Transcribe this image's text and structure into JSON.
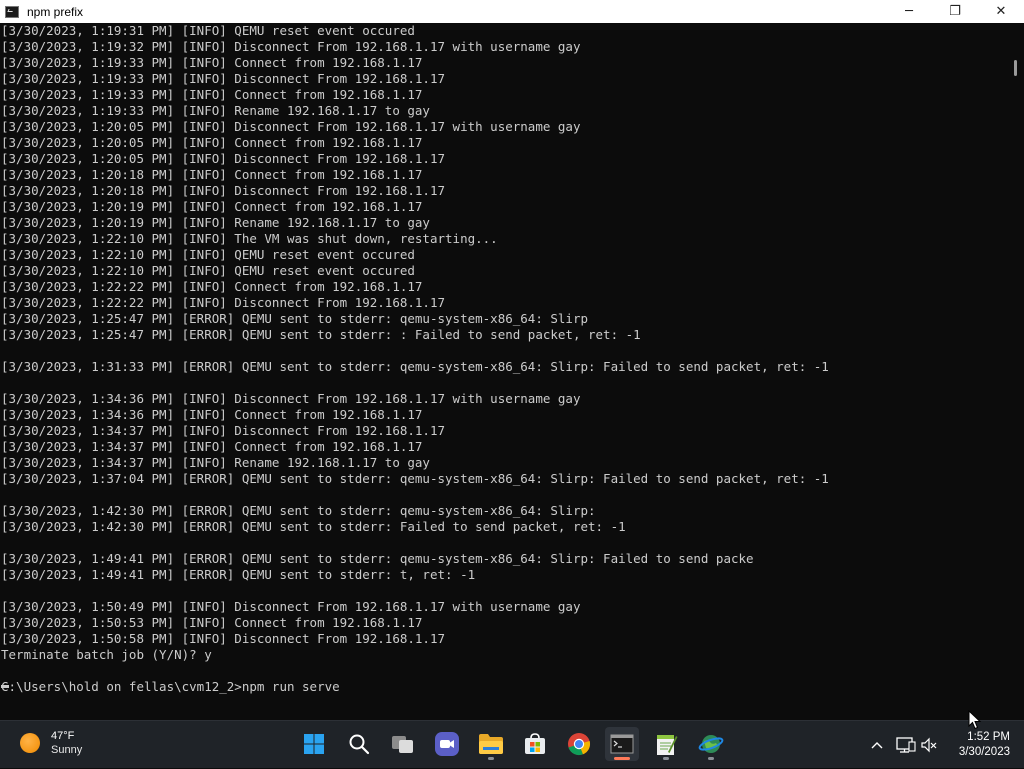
{
  "window": {
    "title": "npm prefix",
    "minimize_glyph": "─",
    "maximize_glyph": "❐",
    "close_glyph": "✕"
  },
  "console": {
    "lines": [
      "[3/30/2023, 1:19:31 PM] [INFO] QEMU reset event occured",
      "[3/30/2023, 1:19:32 PM] [INFO] Disconnect From 192.168.1.17 with username gay",
      "[3/30/2023, 1:19:33 PM] [INFO] Connect from 192.168.1.17",
      "[3/30/2023, 1:19:33 PM] [INFO] Disconnect From 192.168.1.17",
      "[3/30/2023, 1:19:33 PM] [INFO] Connect from 192.168.1.17",
      "[3/30/2023, 1:19:33 PM] [INFO] Rename 192.168.1.17 to gay",
      "[3/30/2023, 1:20:05 PM] [INFO] Disconnect From 192.168.1.17 with username gay",
      "[3/30/2023, 1:20:05 PM] [INFO] Connect from 192.168.1.17",
      "[3/30/2023, 1:20:05 PM] [INFO] Disconnect From 192.168.1.17",
      "[3/30/2023, 1:20:18 PM] [INFO] Connect from 192.168.1.17",
      "[3/30/2023, 1:20:18 PM] [INFO] Disconnect From 192.168.1.17",
      "[3/30/2023, 1:20:19 PM] [INFO] Connect from 192.168.1.17",
      "[3/30/2023, 1:20:19 PM] [INFO] Rename 192.168.1.17 to gay",
      "[3/30/2023, 1:22:10 PM] [INFO] The VM was shut down, restarting...",
      "[3/30/2023, 1:22:10 PM] [INFO] QEMU reset event occured",
      "[3/30/2023, 1:22:10 PM] [INFO] QEMU reset event occured",
      "[3/30/2023, 1:22:22 PM] [INFO] Connect from 192.168.1.17",
      "[3/30/2023, 1:22:22 PM] [INFO] Disconnect From 192.168.1.17",
      "[3/30/2023, 1:25:47 PM] [ERROR] QEMU sent to stderr: qemu-system-x86_64: Slirp",
      "[3/30/2023, 1:25:47 PM] [ERROR] QEMU sent to stderr: : Failed to send packet, ret: -1",
      "",
      "[3/30/2023, 1:31:33 PM] [ERROR] QEMU sent to stderr: qemu-system-x86_64: Slirp: Failed to send packet, ret: -1",
      "",
      "[3/30/2023, 1:34:36 PM] [INFO] Disconnect From 192.168.1.17 with username gay",
      "[3/30/2023, 1:34:36 PM] [INFO] Connect from 192.168.1.17",
      "[3/30/2023, 1:34:37 PM] [INFO] Disconnect From 192.168.1.17",
      "[3/30/2023, 1:34:37 PM] [INFO] Connect from 192.168.1.17",
      "[3/30/2023, 1:34:37 PM] [INFO] Rename 192.168.1.17 to gay",
      "[3/30/2023, 1:37:04 PM] [ERROR] QEMU sent to stderr: qemu-system-x86_64: Slirp: Failed to send packet, ret: -1",
      "",
      "[3/30/2023, 1:42:30 PM] [ERROR] QEMU sent to stderr: qemu-system-x86_64: Slirp:",
      "[3/30/2023, 1:42:30 PM] [ERROR] QEMU sent to stderr: Failed to send packet, ret: -1",
      "",
      "[3/30/2023, 1:49:41 PM] [ERROR] QEMU sent to stderr: qemu-system-x86_64: Slirp: Failed to send packe",
      "[3/30/2023, 1:49:41 PM] [ERROR] QEMU sent to stderr: t, ret: -1",
      "",
      "[3/30/2023, 1:50:49 PM] [INFO] Disconnect From 192.168.1.17 with username gay",
      "[3/30/2023, 1:50:53 PM] [INFO] Connect from 192.168.1.17",
      "[3/30/2023, 1:50:58 PM] [INFO] Disconnect From 192.168.1.17",
      "Terminate batch job (Y/N)? y",
      "",
      "C:\\Users\\hold on fellas\\cvm12_2>npm run serve"
    ]
  },
  "taskbar": {
    "weather": {
      "temp": "47°F",
      "condition": "Sunny"
    },
    "pinned": [
      {
        "name": "start",
        "icon": "windows-logo-icon"
      },
      {
        "name": "search",
        "icon": "search-icon"
      },
      {
        "name": "task-view",
        "icon": "task-view-icon"
      },
      {
        "name": "teams-chat",
        "icon": "video-chat-icon"
      },
      {
        "name": "file-explorer",
        "icon": "folder-icon"
      },
      {
        "name": "microsoft-store",
        "icon": "store-icon"
      },
      {
        "name": "chrome",
        "icon": "chrome-icon"
      },
      {
        "name": "command-prompt",
        "icon": "terminal-icon"
      },
      {
        "name": "notepad-plus-plus",
        "icon": "notepad-icon"
      },
      {
        "name": "network-app",
        "icon": "globe-icon"
      }
    ],
    "clock": {
      "time": "1:52 PM",
      "date": "3/30/2023"
    }
  },
  "colors": {
    "console_bg": "#0c0c0c",
    "console_text": "#cccccc",
    "taskbar_bg": "#1f2328",
    "active_indicator": "#ff7a59"
  }
}
